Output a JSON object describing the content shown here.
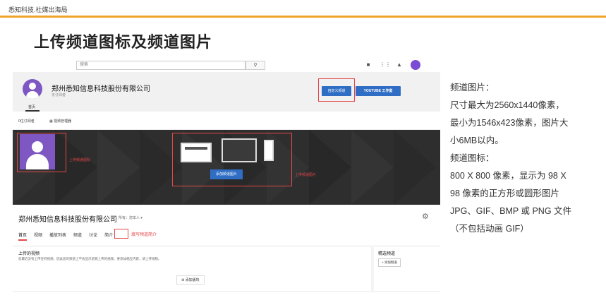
{
  "brand": "悉知科技.社媒出海局",
  "slide_title": "上传频道图标及频道图片",
  "shot": {
    "search_placeholder": "搜索",
    "search_icon": "magnifier",
    "channel_name": "郑州悉知信息科技股份有限公司",
    "subscribers": "无订阅者",
    "customize_button": "自定义频道",
    "studio_button": "YOUTUBE 工作室",
    "home_tab": "首页",
    "subs_count": "0位订阅者",
    "video_manager": "视频管理器",
    "avatar_label": "上传频道图标",
    "add_banner_button": "添加频道图片",
    "banner_label": "上传频道图片",
    "name_big": "郑州悉知信息科技股份有限公司",
    "owner_text": "所有：您本人 ▾",
    "tabs": [
      "首页",
      "视频",
      "播放列表",
      "频道",
      "讨论",
      "简介"
    ],
    "about_label": "填写频道简介",
    "uploads_title": "上传的视频",
    "uploads_msg": "您最近没有上传任何视频，因此您的频道上不会显示近期上传的视频。要添加相应内容，请上传视频。",
    "add_module": "添加版块",
    "featured_title": "精选频道",
    "featured_button": "+ 添加频道",
    "accent_red": "#e34848",
    "accent_blue": "#2f6ec4"
  },
  "notes": [
    "频道图片：",
    "尺寸最大为2560x1440像素，",
    "最小为1546x423像素，图片大",
    "小6MB以内。",
    "频道图标：",
    "800 X 800 像素，显示为 98 X",
    "98 像素的正方形或圆形图片",
    "JPG、GIF、BMP 或 PNG 文件",
    "（不包括动画 GIF）"
  ]
}
